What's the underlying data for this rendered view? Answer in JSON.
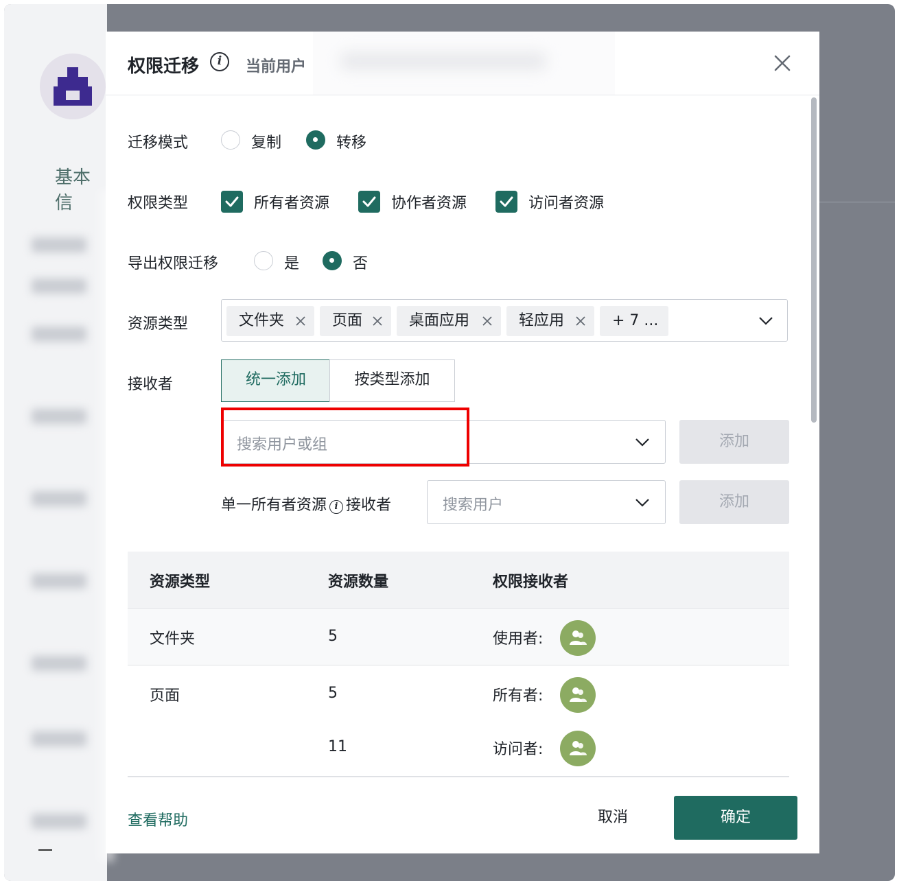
{
  "background": {
    "title": "基本信"
  },
  "dialog": {
    "title": "权限迁移",
    "current_user_label": "当前用户"
  },
  "migrate_mode": {
    "label": "迁移模式",
    "options": [
      {
        "label": "复制",
        "selected": false
      },
      {
        "label": "转移",
        "selected": true
      }
    ]
  },
  "permission_type": {
    "label": "权限类型",
    "options": [
      {
        "label": "所有者资源",
        "checked": true
      },
      {
        "label": "协作者资源",
        "checked": true
      },
      {
        "label": "访问者资源",
        "checked": true
      }
    ]
  },
  "export_migration": {
    "label": "导出权限迁移",
    "options": [
      {
        "label": "是",
        "selected": false
      },
      {
        "label": "否",
        "selected": true
      }
    ]
  },
  "resource_type": {
    "label": "资源类型",
    "tags": [
      "文件夹",
      "页面",
      "桌面应用",
      "轻应用"
    ],
    "more": "+ 7 ..."
  },
  "receiver": {
    "label": "接收者",
    "tabs": [
      "统一添加",
      "按类型添加"
    ],
    "active_tab": "统一添加",
    "search_placeholder": "搜索用户或组",
    "add_label": "添加",
    "single_owner_label": "单一所有者资源",
    "single_receiver_label": "接收者",
    "single_search_placeholder": "搜索用户"
  },
  "table": {
    "headers": [
      "资源类型",
      "资源数量",
      "权限接收者"
    ],
    "rows": [
      {
        "type": "文件夹",
        "count": "5",
        "role": "使用者:"
      },
      {
        "type": "页面",
        "count": "5",
        "role": "所有者:"
      },
      {
        "type": "",
        "count": "11",
        "role": "访问者:"
      }
    ]
  },
  "footer": {
    "help": "查看帮助",
    "cancel": "取消",
    "confirm": "确定"
  },
  "colors": {
    "primary": "#1f6b60",
    "avatar": "#8cab62",
    "highlight": "#ee0000"
  }
}
